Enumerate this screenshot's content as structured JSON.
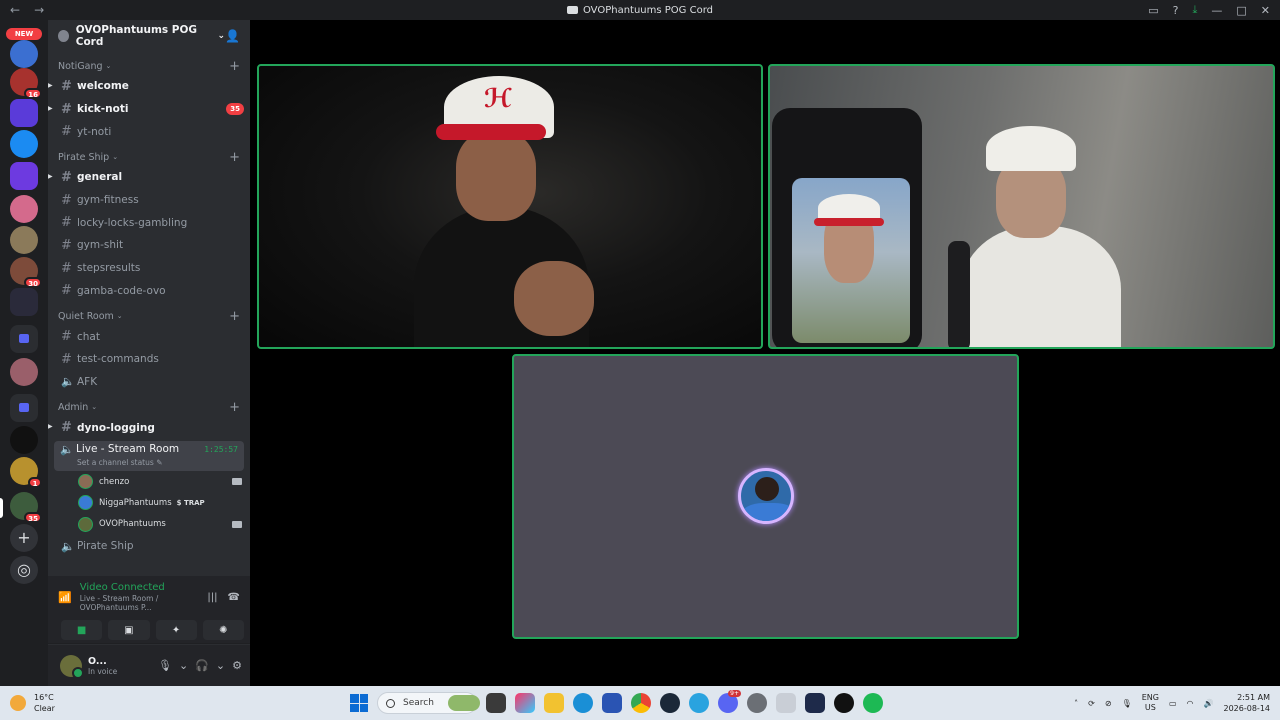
{
  "window": {
    "title": "OVOPhantuums POG Cord"
  },
  "guild_rail": {
    "new_label": "NEW",
    "badges": [
      "16",
      "30",
      "1",
      "35"
    ]
  },
  "server": {
    "name": "OVOPhantuums POG Cord",
    "categories": [
      {
        "name": "NotiGang",
        "channels": [
          {
            "name": "welcome",
            "unread": true
          },
          {
            "name": "kick-noti",
            "unread": true,
            "mentions": "35"
          },
          {
            "name": "yt-noti",
            "unread": false
          }
        ]
      },
      {
        "name": "Pirate Ship",
        "channels": [
          {
            "name": "general",
            "unread": true
          },
          {
            "name": "gym-fitness"
          },
          {
            "name": "locky-locks-gambling"
          },
          {
            "name": "gym-shit"
          },
          {
            "name": "stepsresults"
          },
          {
            "name": "gamba-code-ovo"
          }
        ]
      },
      {
        "name": "Quiet Room",
        "channels": [
          {
            "name": "chat"
          },
          {
            "name": "test-commands"
          },
          {
            "name": "AFK",
            "voice": true
          }
        ]
      },
      {
        "name": "Admin",
        "channels": [
          {
            "name": "dyno-logging",
            "unread": true
          }
        ]
      }
    ],
    "active_voice": {
      "name": "Live - Stream Room",
      "timer": "1:25:57",
      "status": "Set a channel status",
      "users": [
        {
          "name": "chenzo",
          "camera": true
        },
        {
          "name": "NiggaPhantuums",
          "tag": "TRAP"
        },
        {
          "name": "OVOPhantuums",
          "camera": true
        }
      ]
    },
    "trailing_voice": "Pirate Ship"
  },
  "rtc": {
    "status": "Video Connected",
    "location": "Live - Stream Room / OVOPhantuums P..."
  },
  "user": {
    "name": "O...",
    "status": "In voice"
  },
  "taskbar": {
    "temperature": "16°C",
    "weather": "Clear",
    "search_placeholder": "Search",
    "lang": "ENG",
    "region": "US",
    "time": "2:51 AM",
    "date": "2026-08-14",
    "app_badge": "9+"
  },
  "colors": {
    "speaking": "#23a55a",
    "accent": "#5865f2",
    "mention": "#f23f43"
  }
}
